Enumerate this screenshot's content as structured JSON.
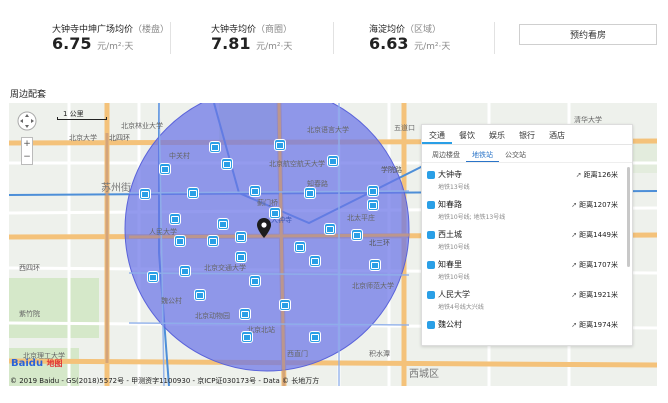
{
  "prices": [
    {
      "label": "大钟寺中坤广场均价",
      "sub": "（楼盘）",
      "value": "6.75",
      "unit": "元/m²·天"
    },
    {
      "label": "大钟寺均价",
      "sub": "（商圈）",
      "value": "7.81",
      "unit": "元/m²·天"
    },
    {
      "label": "海淀均价",
      "sub": "（区域）",
      "value": "6.63",
      "unit": "元/m²·天"
    }
  ],
  "book_button": "预约看房",
  "section_title": "周边配套",
  "map": {
    "scale": "1 公里",
    "zoom_in": "+",
    "zoom_out": "−",
    "circle_color": "#6b74e8",
    "labels": [
      {
        "text": "北京林业大学",
        "big": false
      },
      {
        "text": "五道口",
        "big": false
      },
      {
        "text": "北京语言大学",
        "big": false
      },
      {
        "text": "清华大学",
        "big": false
      },
      {
        "text": "北京大学",
        "big": false
      },
      {
        "text": "北四环",
        "big": false
      },
      {
        "text": "苏州街",
        "big": true
      },
      {
        "text": "中关村",
        "big": false
      },
      {
        "text": "人民大学",
        "big": false
      },
      {
        "text": "知春路",
        "big": false
      },
      {
        "text": "北京航空航天大学",
        "big": false
      },
      {
        "text": "学院路",
        "big": false
      },
      {
        "text": "北三环",
        "big": false
      },
      {
        "text": "北太平庄",
        "big": false
      },
      {
        "text": "北京师范大学",
        "big": false
      },
      {
        "text": "魏公村",
        "big": false
      },
      {
        "text": "北京交通大学",
        "big": false
      },
      {
        "text": "北京动物园",
        "big": false
      },
      {
        "text": "西直门",
        "big": false
      },
      {
        "text": "积水潭",
        "big": false
      },
      {
        "text": "紫竹院",
        "big": false
      },
      {
        "text": "西城区",
        "big": true
      },
      {
        "text": "北京理工大学",
        "big": false
      },
      {
        "text": "北京北站",
        "big": false
      },
      {
        "text": "西四环",
        "big": false
      },
      {
        "text": "大钟寺",
        "big": false
      },
      {
        "text": "蓟门桥",
        "big": false
      }
    ],
    "copyright": "© 2019 Baidu - GS(2018)5572号 - 甲测资字1100930 - 京ICP证030173号 - Data © 长地万方",
    "logo_main": "Baidu",
    "logo_sub": "地图"
  },
  "panel": {
    "tabs": [
      "交通",
      "餐饮",
      "娱乐",
      "银行",
      "酒店"
    ],
    "subtabs": [
      "周边楼盘",
      "地铁站",
      "公交站"
    ],
    "items": [
      {
        "name": "大钟寺",
        "lines": "地铁13号线",
        "dist": "距离126米"
      },
      {
        "name": "知春路",
        "lines": "地铁10号线; 地铁13号线",
        "dist": "距离1207米"
      },
      {
        "name": "西土城",
        "lines": "地铁10号线",
        "dist": "距离1449米"
      },
      {
        "name": "知春里",
        "lines": "地铁10号线",
        "dist": "距离1707米"
      },
      {
        "name": "人民大学",
        "lines": "地铁4号线大兴线",
        "dist": "距离1921米"
      },
      {
        "name": "魏公村",
        "lines": "",
        "dist": "距离1974米"
      }
    ]
  }
}
